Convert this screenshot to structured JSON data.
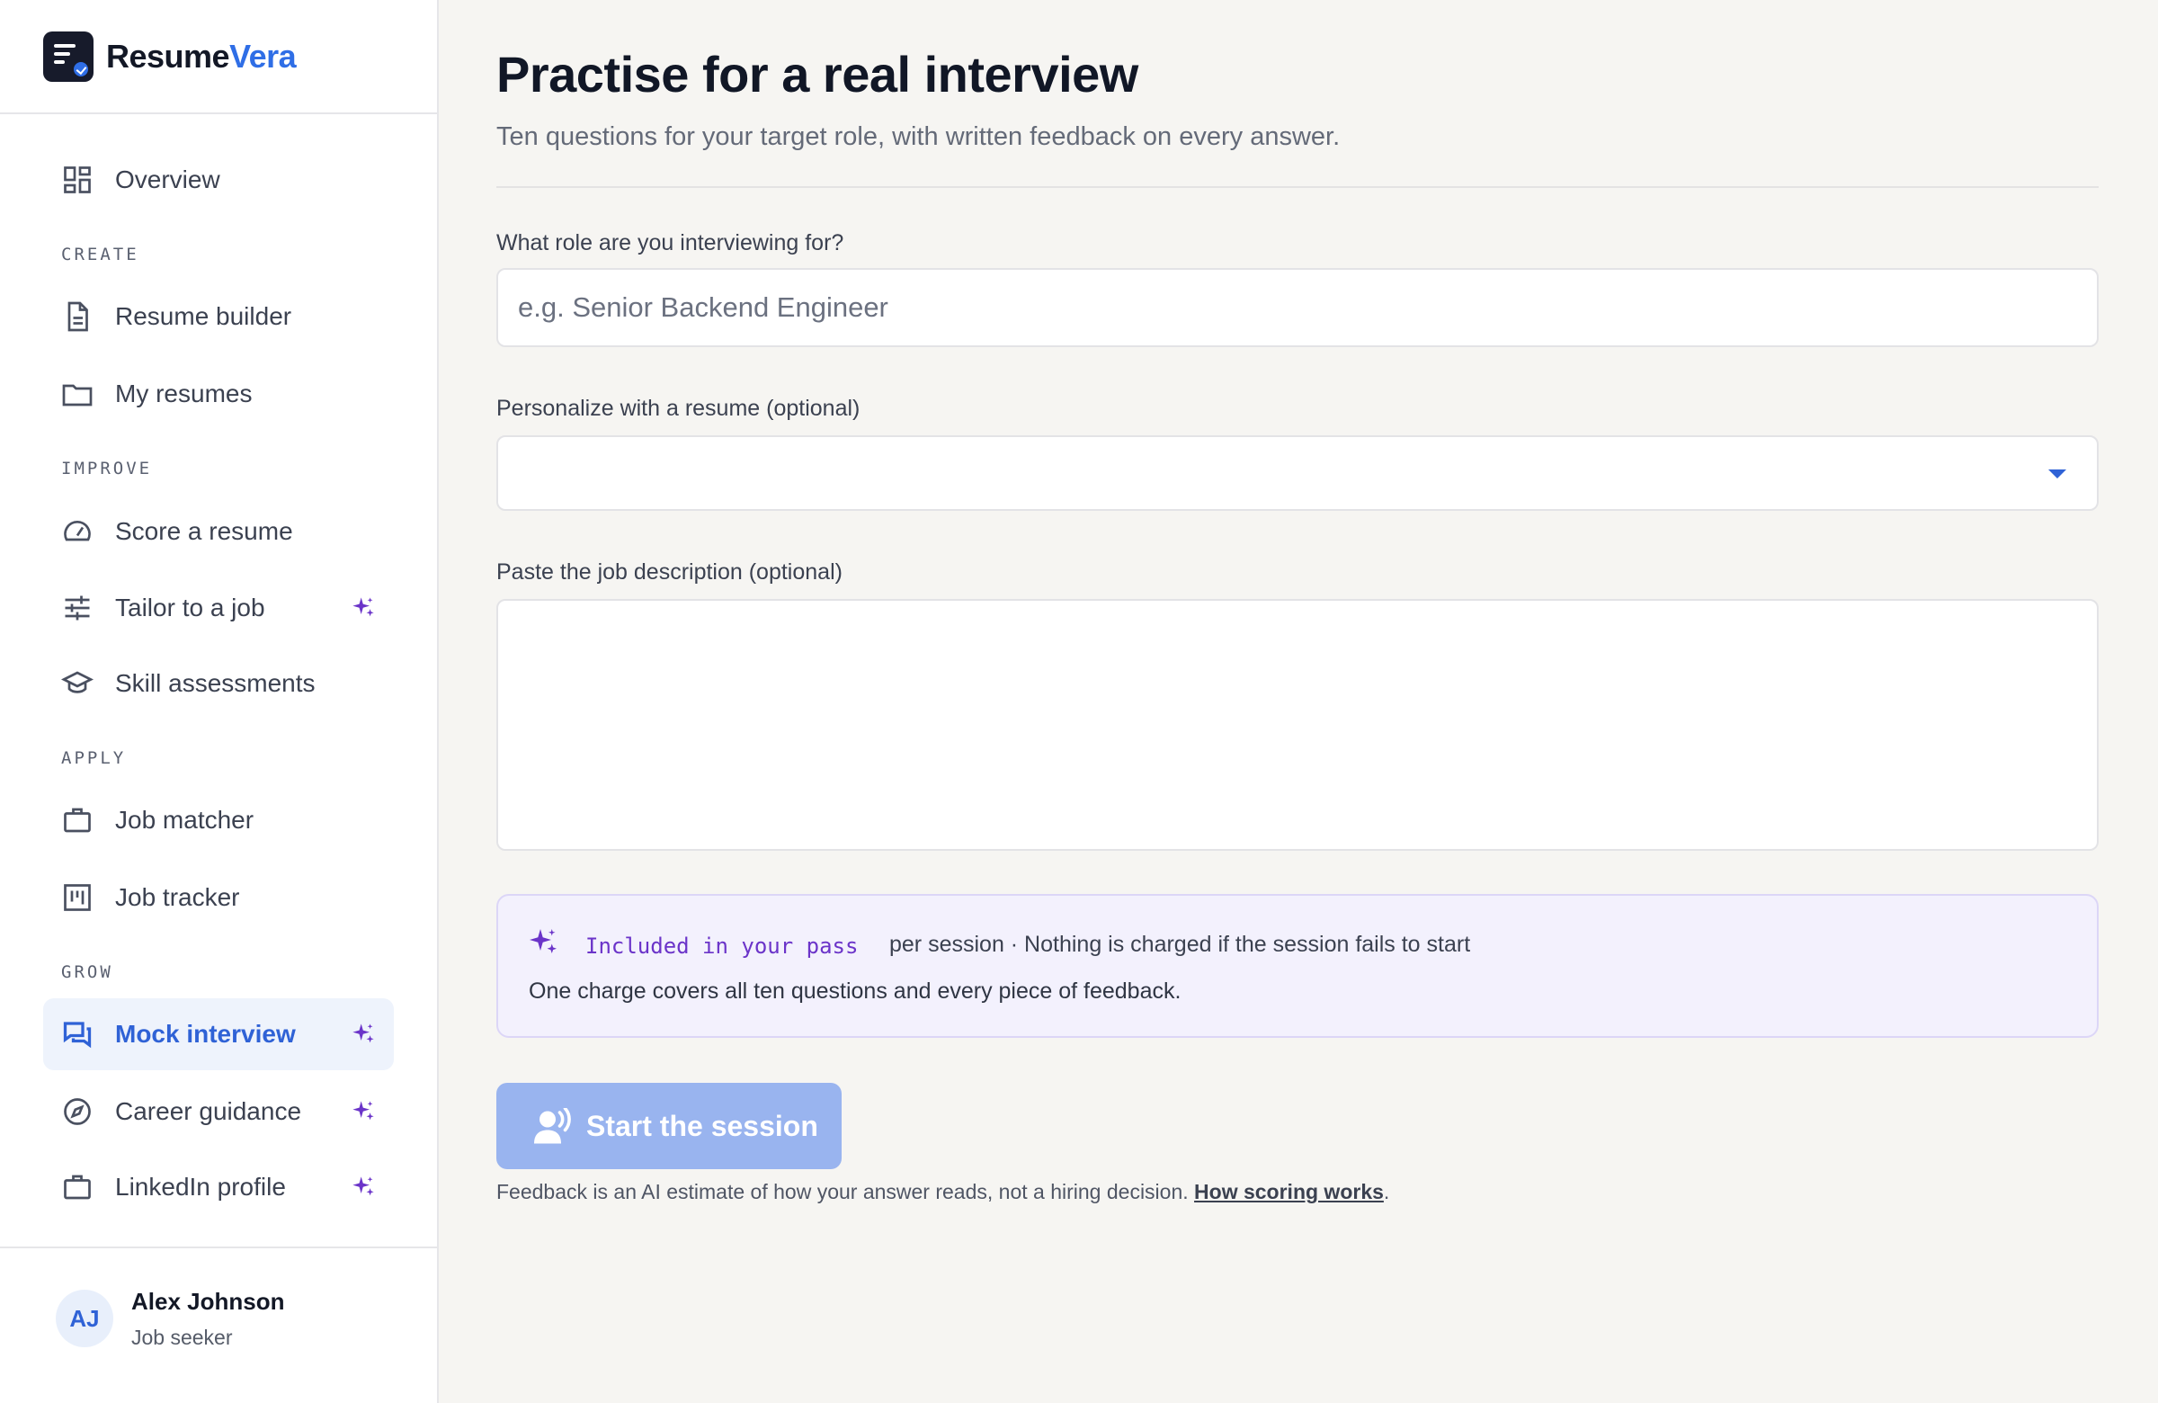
{
  "brand": {
    "name_part1": "Resume",
    "name_part2": "Vera"
  },
  "sidebar": {
    "overview": "Overview",
    "sections": {
      "create": "CREATE",
      "improve": "IMPROVE",
      "apply": "APPLY",
      "grow": "GROW"
    },
    "items": {
      "resume_builder": "Resume builder",
      "my_resumes": "My resumes",
      "score_resume": "Score a resume",
      "tailor_job": "Tailor to a job",
      "skill_assessments": "Skill assessments",
      "job_matcher": "Job matcher",
      "job_tracker": "Job tracker",
      "mock_interview": "Mock interview",
      "career_guidance": "Career guidance",
      "linkedin_profile": "LinkedIn profile"
    },
    "active_item": "Mock interview"
  },
  "user": {
    "initials": "AJ",
    "name": "Alex Johnson",
    "role": "Job seeker"
  },
  "main": {
    "title": "Practise for a real interview",
    "subtitle": "Ten questions for your target role, with written feedback on every answer.",
    "role_field": {
      "label": "What role are you interviewing for?",
      "value": "",
      "placeholder": "e.g. Senior Backend Engineer"
    },
    "resume_field": {
      "label": "Personalize with a resume (optional)",
      "value": ""
    },
    "jd_field": {
      "label": "Paste the job description (optional)",
      "value": ""
    },
    "info": {
      "pass": "Included in your pass",
      "per_session": "per session · Nothing is charged if the session fails to start",
      "note": "One charge covers all ten questions and every piece of feedback."
    },
    "start_button": "Start the session",
    "disclaimer_text": "Feedback is an AI estimate of how your answer reads, not a hiring decision. ",
    "disclaimer_link": "How scoring works",
    "disclaimer_end": "."
  },
  "colors": {
    "accent": "#2f6ee6",
    "active_text": "#2f62d6",
    "spark": "#6b34c9",
    "button_disabled": "#99b4ef",
    "info_bg": "#f3f1fd"
  },
  "icons": {
    "overview": "dashboard-icon",
    "resume_builder": "document-icon",
    "my_resumes": "folder-icon",
    "score_resume": "gauge-icon",
    "tailor_job": "sliders-icon",
    "skill_assessments": "graduation-cap-icon",
    "job_matcher": "briefcase-icon",
    "job_tracker": "kanban-icon",
    "mock_interview": "chat-bubbles-icon",
    "career_guidance": "compass-icon",
    "linkedin_profile": "briefcase-icon",
    "ai": "sparkle-icon",
    "start": "person-speaking-icon"
  }
}
